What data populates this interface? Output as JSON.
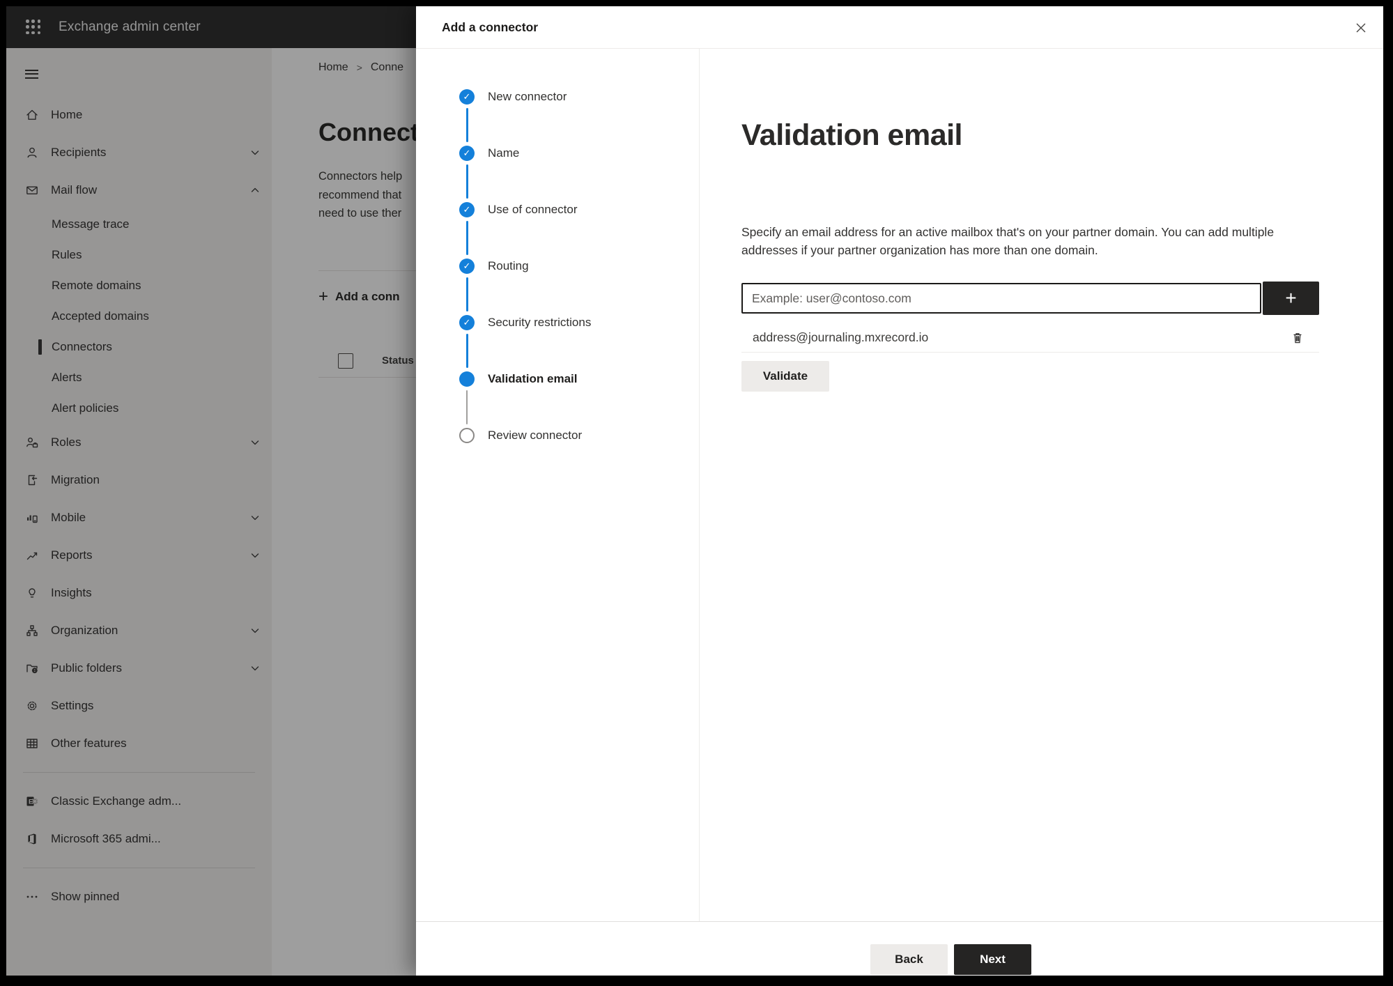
{
  "topbar": {
    "title": "Exchange admin center"
  },
  "sidebar": {
    "items": [
      {
        "label": "Home",
        "icon": "home-icon"
      },
      {
        "label": "Recipients",
        "icon": "person-icon",
        "chevron": "down"
      },
      {
        "label": "Mail flow",
        "icon": "mail-icon",
        "chevron": "up"
      },
      {
        "label": "Message trace",
        "sub": true
      },
      {
        "label": "Rules",
        "sub": true
      },
      {
        "label": "Remote domains",
        "sub": true
      },
      {
        "label": "Accepted domains",
        "sub": true
      },
      {
        "label": "Connectors",
        "sub": true,
        "selected": true
      },
      {
        "label": "Alerts",
        "sub": true
      },
      {
        "label": "Alert policies",
        "sub": true
      },
      {
        "label": "Roles",
        "icon": "roles-icon",
        "chevron": "down"
      },
      {
        "label": "Migration",
        "icon": "migration-icon"
      },
      {
        "label": "Mobile",
        "icon": "mobile-icon",
        "chevron": "down"
      },
      {
        "label": "Reports",
        "icon": "reports-icon",
        "chevron": "down"
      },
      {
        "label": "Insights",
        "icon": "insights-icon"
      },
      {
        "label": "Organization",
        "icon": "organization-icon",
        "chevron": "down"
      },
      {
        "label": "Public folders",
        "icon": "public-folders-icon",
        "chevron": "down"
      },
      {
        "label": "Settings",
        "icon": "settings-icon"
      },
      {
        "label": "Other features",
        "icon": "other-features-icon"
      },
      {
        "label": "Classic Exchange adm...",
        "icon": "exchange-icon"
      },
      {
        "label": "Microsoft 365 admi...",
        "icon": "microsoft365-icon"
      },
      {
        "label": "Show pinned",
        "icon": "ellipsis-icon"
      }
    ]
  },
  "page": {
    "breadcrumb": {
      "home": "Home",
      "current": "Conne"
    },
    "title": "Connect",
    "desc_line1": "Connectors help",
    "desc_line2": "recommend that",
    "desc_line3": "need to use ther",
    "add_button": "Add a conn",
    "status_header": "Status"
  },
  "wizard": {
    "title": "Add a connector",
    "steps": [
      {
        "label": "New connector",
        "state": "done"
      },
      {
        "label": "Name",
        "state": "done"
      },
      {
        "label": "Use of connector",
        "state": "done"
      },
      {
        "label": "Routing",
        "state": "done"
      },
      {
        "label": "Security restrictions",
        "state": "done"
      },
      {
        "label": "Validation email",
        "state": "current"
      },
      {
        "label": "Review connector",
        "state": "todo"
      }
    ],
    "check_glyph": "✓"
  },
  "panel": {
    "heading": "Validation email",
    "description": "Specify an email address for an active mailbox that's on your partner domain. You can add multiple addresses if your partner organization has more than one domain.",
    "email_input": {
      "value": "",
      "placeholder": "Example: user@contoso.com"
    },
    "add_button": "+",
    "addresses": [
      {
        "email": "address@journaling.mxrecord.io"
      }
    ],
    "validate_button": "Validate"
  },
  "footer": {
    "back": "Back",
    "next": "Next"
  },
  "colors": {
    "accent": "#1480da",
    "dark_button": "#252423",
    "light_button": "#edebe9",
    "topbar": "#2b2b2b"
  }
}
